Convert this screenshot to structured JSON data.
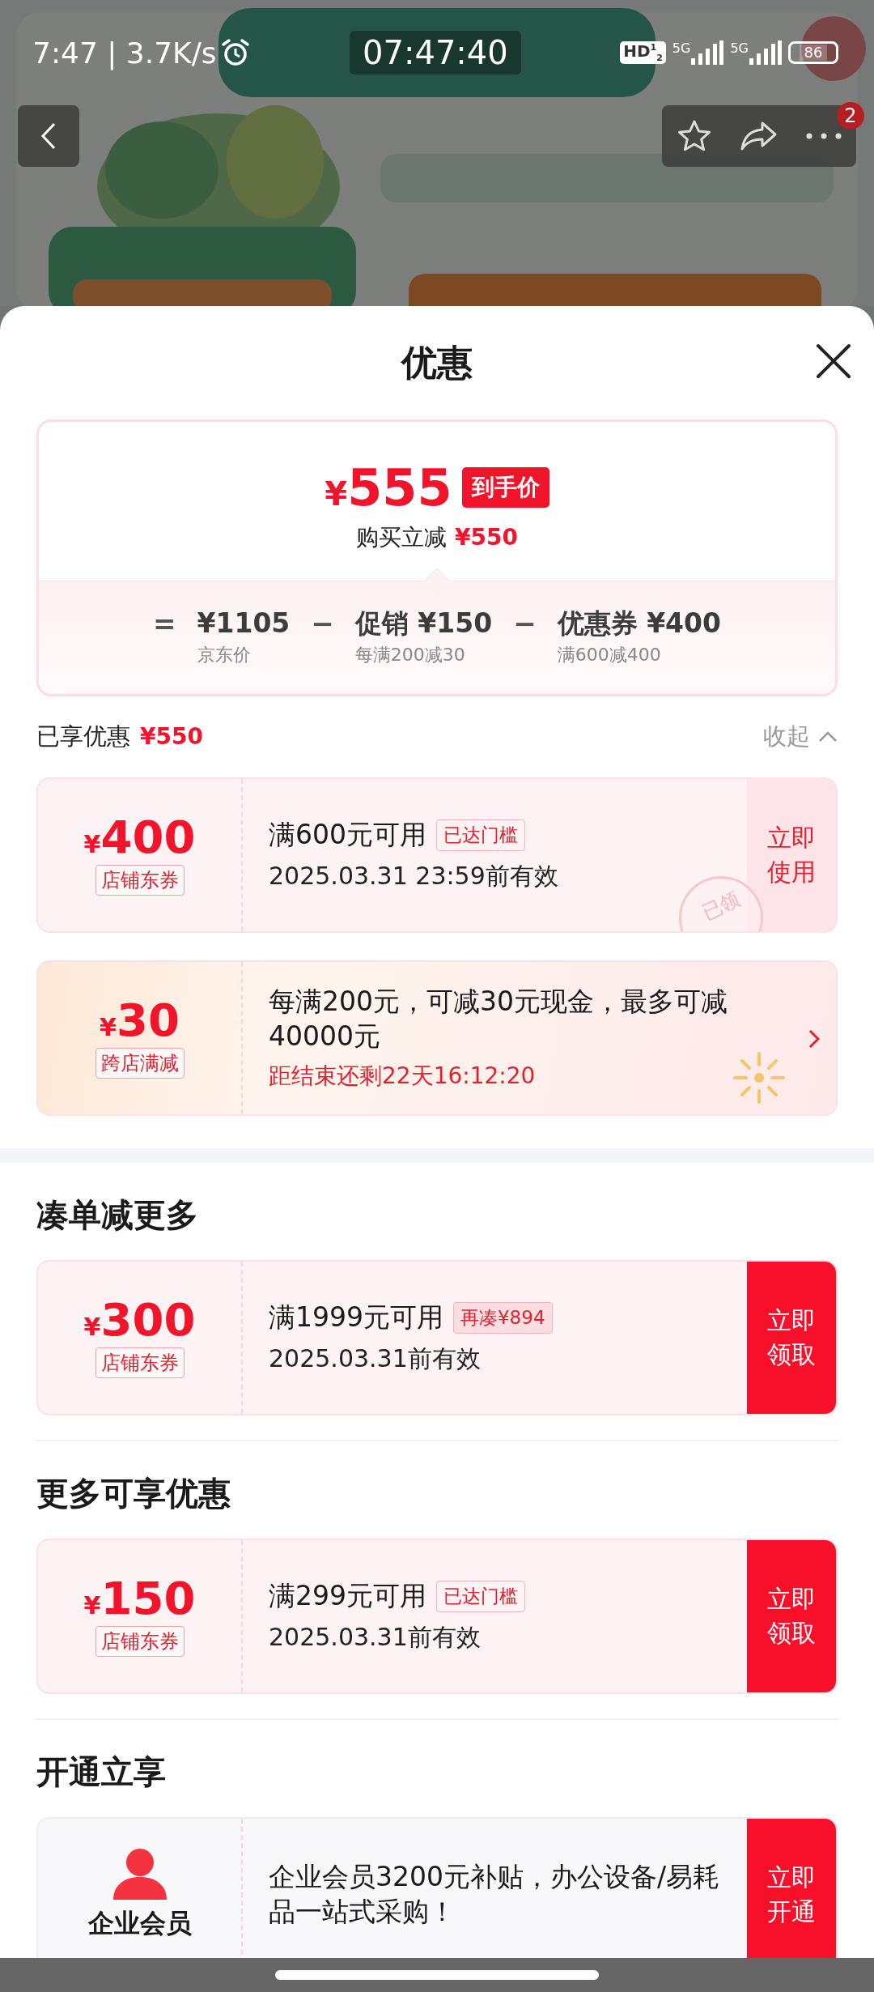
{
  "status_bar": {
    "time": "7:47 | 3.7K/s",
    "clock": "07:47:40",
    "hd": "HD$^{1}$$_{2}$",
    "networks": [
      "5G",
      "5G"
    ],
    "battery": "86"
  },
  "header": {
    "badge": "2"
  },
  "sheet": {
    "title": "优惠",
    "price": {
      "currency": "¥",
      "amount": "555",
      "tag": "到手价",
      "saving_label": "购买立减",
      "saving": "¥550"
    },
    "breakdown": [
      {
        "op": "=",
        "value": "¥1105",
        "note": "京东价"
      },
      {
        "op": "−",
        "label": "促销",
        "value": "¥150",
        "note": "每满200减30"
      },
      {
        "op": "−",
        "label": "优惠券",
        "value": "¥400",
        "note": "满600减400"
      }
    ],
    "enjoyed": {
      "label": "已享优惠",
      "amount": "¥550",
      "toggle": "收起",
      "expanded": true
    },
    "sections": [
      {
        "coupons": [
          {
            "kind": "coupon",
            "currency": "¥",
            "amount": "400",
            "tag": "店铺东券",
            "condition": "满600元可用",
            "badge": {
              "text": "已达门槛",
              "kind": "reached"
            },
            "validity": "2025.03.31 23:59前有效",
            "action": {
              "text": "立即使用",
              "kind": "use"
            },
            "stamp": "已领"
          },
          {
            "kind": "promo",
            "currency": "¥",
            "amount": "30",
            "tag": "跨店满减",
            "description": "每满200元，可减30元现金，最多可减40000元",
            "countdown": "距结束还剩22天16:12:20"
          }
        ]
      },
      {
        "heading": "凑单减更多",
        "coupons": [
          {
            "kind": "coupon",
            "currency": "¥",
            "amount": "300",
            "tag": "店铺东券",
            "condition": "满1999元可用",
            "badge": {
              "text": "再凑¥894",
              "kind": "more"
            },
            "validity": "2025.03.31前有效",
            "action": {
              "text": "立即领取",
              "kind": "claim"
            }
          }
        ]
      },
      {
        "heading": "更多可享优惠",
        "coupons": [
          {
            "kind": "coupon",
            "currency": "¥",
            "amount": "150",
            "tag": "店铺东券",
            "condition": "满299元可用",
            "badge": {
              "text": "已达门槛",
              "kind": "reached"
            },
            "validity": "2025.03.31前有效",
            "action": {
              "text": "立即领取",
              "kind": "claim"
            }
          }
        ]
      },
      {
        "heading": "开通立享",
        "coupons": [
          {
            "kind": "member",
            "label": "企业会员",
            "description": "企业会员3200元补贴，办公设备/易耗品一站式采购！",
            "action": {
              "text": "立即开通",
              "kind": "claim"
            }
          }
        ]
      }
    ]
  }
}
